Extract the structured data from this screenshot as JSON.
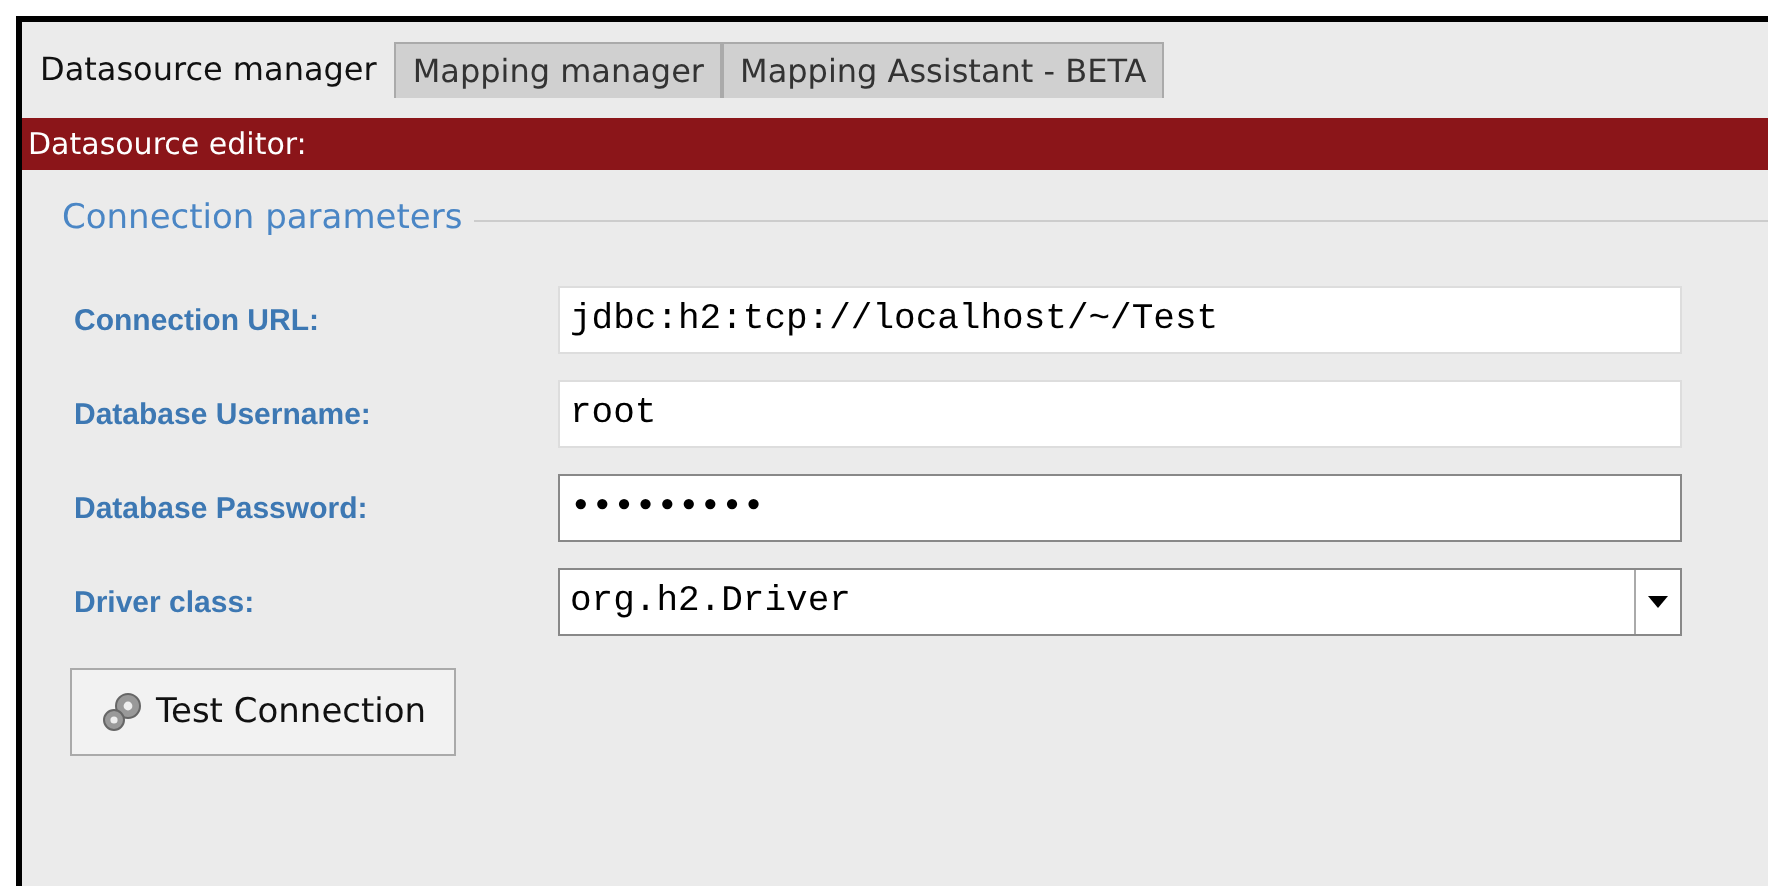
{
  "tabs": [
    {
      "label": "Datasource manager",
      "selected": true
    },
    {
      "label": "Mapping manager",
      "selected": false
    },
    {
      "label": "Mapping Assistant - BETA",
      "selected": false
    }
  ],
  "editor_header": "Datasource editor:",
  "group": {
    "title": "Connection parameters",
    "fields": [
      {
        "label": "Connection URL:",
        "kind": "text",
        "value": "jdbc:h2:tcp://localhost/~/Test",
        "focused": false
      },
      {
        "label": "Database Username:",
        "kind": "text",
        "value": "root",
        "focused": false
      },
      {
        "label": "Database Password:",
        "kind": "password",
        "value": "•••••••••",
        "focused": true
      },
      {
        "label": "Driver class:",
        "kind": "select",
        "value": "org.h2.Driver",
        "focused": true
      }
    ]
  },
  "test_button": "Test Connection"
}
